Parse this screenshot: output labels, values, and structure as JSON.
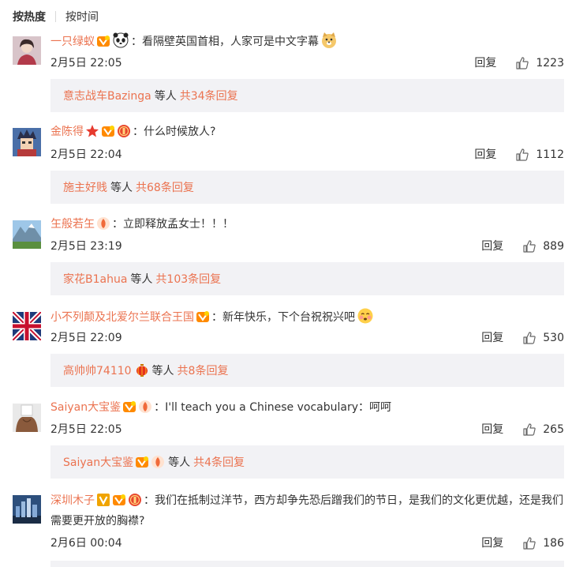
{
  "sort": {
    "hot": "按热度",
    "time": "按时间"
  },
  "comments": [
    {
      "user": "一只绿蚁",
      "text": "看隔壁英国首相，人家可是中文字幕",
      "time": "2月5日 22:05",
      "reply_label": "回复",
      "likes": "1223",
      "sub": {
        "user": "意志战车Bazinga",
        "others": "等人",
        "total": "共34条回复"
      }
    },
    {
      "user": "金陈得",
      "text": "什么时候放人?",
      "time": "2月5日 22:04",
      "reply_label": "回复",
      "likes": "1112",
      "sub": {
        "user": "施主好贱",
        "others": "等人",
        "total": "共68条回复"
      }
    },
    {
      "user": "玍般若玍",
      "text": "立即释放孟女士！！！",
      "time": "2月5日 23:19",
      "reply_label": "回复",
      "likes": "889",
      "sub": {
        "user": "家花B1ahua",
        "others": "等人",
        "total": "共103条回复"
      }
    },
    {
      "user": "小不列颠及北爱尔兰联合王国",
      "text": "新年快乐，下个台祝祝兴吧",
      "time": "2月5日 22:09",
      "reply_label": "回复",
      "likes": "530",
      "sub": {
        "user": "高帅帅74110",
        "others": "等人",
        "total": "共8条回复"
      }
    },
    {
      "user": "Saiyan大宝鉴",
      "text": "I'll teach you a Chinese vocabulary：呵呵",
      "time": "2月5日 22:05",
      "reply_label": "回复",
      "likes": "265",
      "sub": {
        "user": "Saiyan大宝鉴",
        "others": "等人",
        "total": "共4条回复"
      }
    },
    {
      "user": "深圳木子",
      "text": "我们在抵制过洋节，西方却争先恐后蹭我们的节日，是我们的文化更优越，还是我们需要更开放的胸襟?",
      "time": "2月6日 00:04",
      "reply_label": "回复",
      "likes": "186"
    }
  ],
  "colors": {
    "username": "#eb7350",
    "subbox_bg": "#f2f2f5",
    "text": "#333333"
  }
}
